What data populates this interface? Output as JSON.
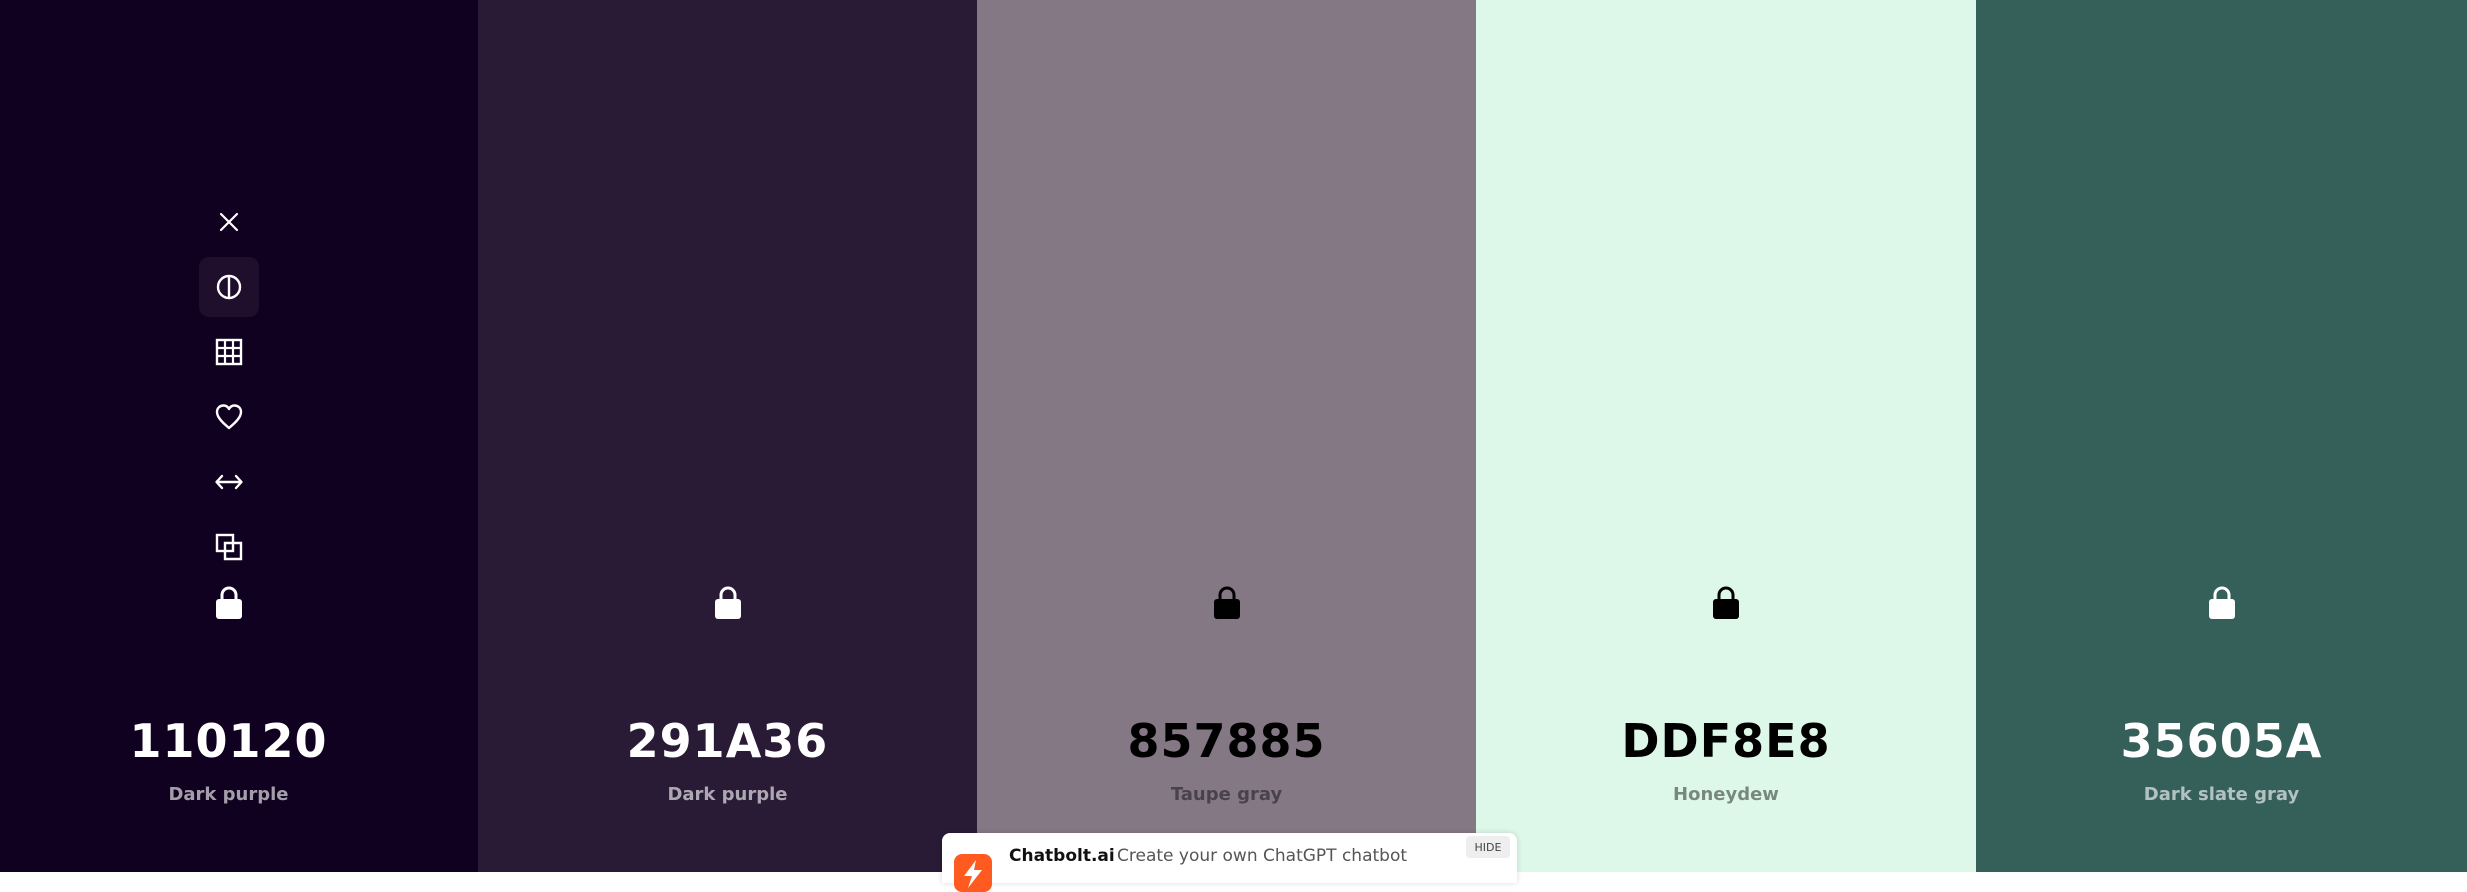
{
  "colors": [
    {
      "hex": "110120",
      "name": "Dark purple",
      "bg": "#110120",
      "fg": "#ffffff",
      "sub": "rgba(255,255,255,0.62)",
      "lock": "#ffffff"
    },
    {
      "hex": "291A36",
      "name": "Dark purple",
      "bg": "#291A36",
      "fg": "#ffffff",
      "sub": "rgba(255,255,255,0.62)",
      "lock": "#ffffff"
    },
    {
      "hex": "857885",
      "name": "Taupe gray",
      "bg": "#857885",
      "fg": "#000000",
      "sub": "rgba(0,0,0,0.45)",
      "lock": "#000000"
    },
    {
      "hex": "DDF8E8",
      "name": "Honeydew",
      "bg": "#DDF8E8",
      "fg": "#000000",
      "sub": "rgba(0,0,0,0.45)",
      "lock": "#000000"
    },
    {
      "hex": "35605A",
      "name": "Dark slate gray",
      "bg": "#35605A",
      "fg": "#ffffff",
      "sub": "rgba(255,255,255,0.62)",
      "lock": "#ffffff"
    }
  ],
  "tools": [
    "close-icon",
    "contrast-icon",
    "grid-icon",
    "heart-icon",
    "drag-arrows-icon",
    "copy-icon"
  ],
  "ad": {
    "brand": "Chatbolt.ai",
    "text": "Create your own ChatGPT chatbot",
    "hide_label": "HIDE",
    "logo_color": "#ff5a1f"
  }
}
